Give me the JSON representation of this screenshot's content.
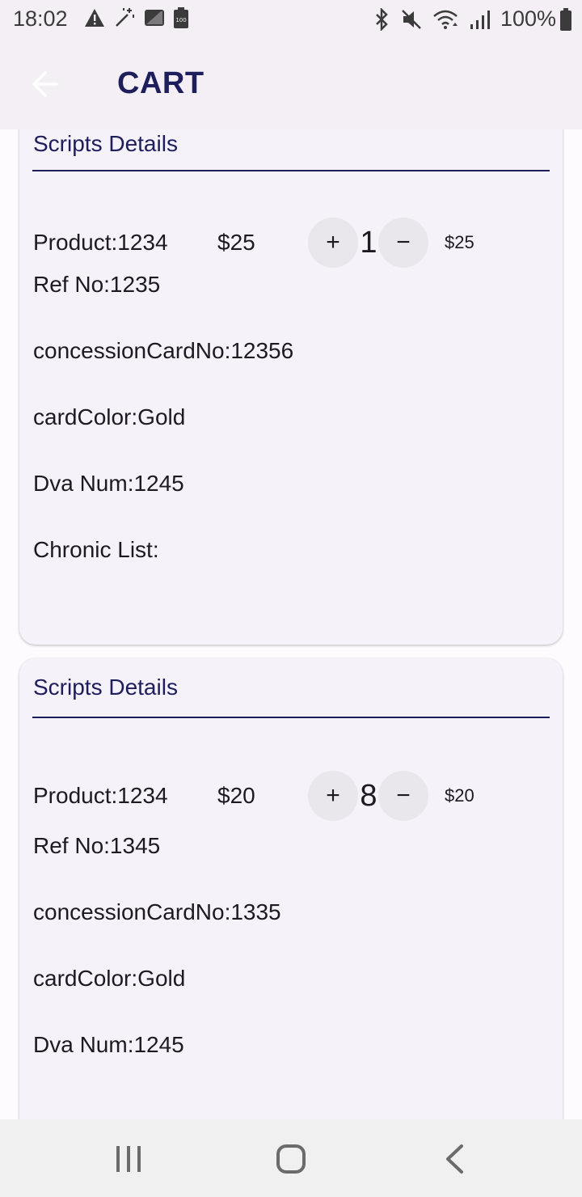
{
  "status_bar": {
    "time": "18:02",
    "left_icons": [
      "warning-icon",
      "magic-wand-icon",
      "image-icon",
      "battery-saver-icon"
    ],
    "right_icons": [
      "bluetooth-icon",
      "mute-icon",
      "wifi-icon",
      "signal-icon"
    ],
    "battery": "100%"
  },
  "app_bar": {
    "back_icon": "arrow-back-icon",
    "title": "CART"
  },
  "cards": [
    {
      "header": "Scripts Details",
      "product": "Product:1234",
      "price": "$25",
      "quantity": "1",
      "line_total": "$25",
      "plus_label": "+",
      "minus_label": "−",
      "ref_no": "Ref No:1235",
      "concession": "concessionCardNo:12356",
      "card_color": "cardColor:Gold",
      "dva": "Dva Num:1245",
      "chronic": "Chronic List:"
    },
    {
      "header": "Scripts Details",
      "product": "Product:1234",
      "price": "$20",
      "quantity": "8",
      "line_total": "$20",
      "plus_label": "+",
      "minus_label": "−",
      "ref_no": "Ref No:1345",
      "concession": "concessionCardNo:1335",
      "card_color": "cardColor:Gold",
      "dva": "Dva Num:1245"
    }
  ],
  "nav_bar": {
    "icons": [
      "recent-apps-icon",
      "home-icon",
      "back-nav-icon"
    ]
  },
  "colors": {
    "accent": "#1e1e5c",
    "card_bg": "#f5f2f9",
    "app_bar_bg": "#f3eff4"
  }
}
